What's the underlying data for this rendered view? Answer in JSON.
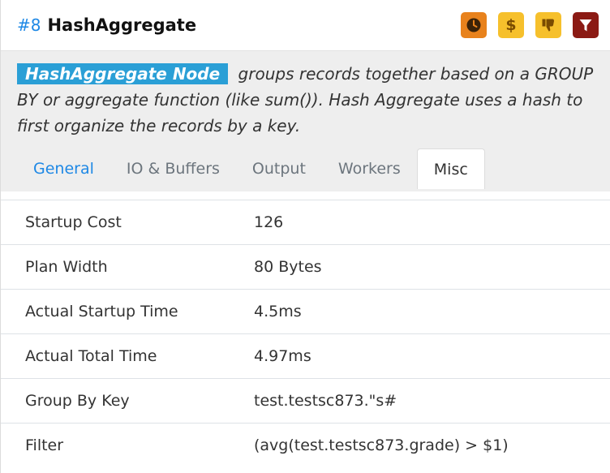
{
  "header": {
    "node_number": "#8",
    "title": "HashAggregate"
  },
  "badges": [
    {
      "name": "clock-icon",
      "color": "#e8821c"
    },
    {
      "name": "dollar-icon",
      "text": "$",
      "color": "#f6c02c"
    },
    {
      "name": "thumbs-down-icon",
      "color": "#f6c02c"
    },
    {
      "name": "filter-icon",
      "color": "#8b1a14"
    }
  ],
  "description": {
    "tag": "HashAggregate Node",
    "text": " groups records together based on a GROUP BY or aggregate function (like sum()). Hash Aggregate uses a hash to first organize the records by a key."
  },
  "tabs": [
    "General",
    "IO & Buffers",
    "Output",
    "Workers",
    "Misc"
  ],
  "active_tab": "Misc",
  "rows": [
    {
      "key": "Startup Cost",
      "value": "126"
    },
    {
      "key": "Plan Width",
      "value": "80 Bytes"
    },
    {
      "key": "Actual Startup Time",
      "value": "4.5ms"
    },
    {
      "key": "Actual Total Time",
      "value": "4.97ms"
    },
    {
      "key": "Group By Key",
      "value": "test.testsc873.\"s#"
    },
    {
      "key": "Filter",
      "value": "(avg(test.testsc873.grade) > $1)"
    }
  ]
}
